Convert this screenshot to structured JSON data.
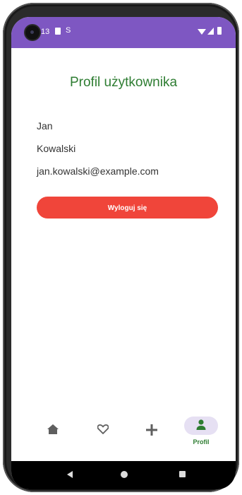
{
  "status_bar": {
    "time": "13",
    "extra_glyph": "S"
  },
  "profile": {
    "title": "Profil użytkownika",
    "first_name": "Jan",
    "last_name": "Kowalski",
    "email": "jan.kowalski@example.com",
    "logout_label": "Wyloguj się"
  },
  "bottom_nav": {
    "items": [
      {
        "icon": "home-icon",
        "label": ""
      },
      {
        "icon": "heart-icon",
        "label": ""
      },
      {
        "icon": "plus-icon",
        "label": ""
      },
      {
        "icon": "person-icon",
        "label": "Profil",
        "selected": true
      }
    ]
  },
  "colors": {
    "status_bar": "#7e57c2",
    "accent_green": "#2e7d32",
    "logout_red": "#f0453a",
    "nav_selected_pill": "#e6e0f3"
  }
}
